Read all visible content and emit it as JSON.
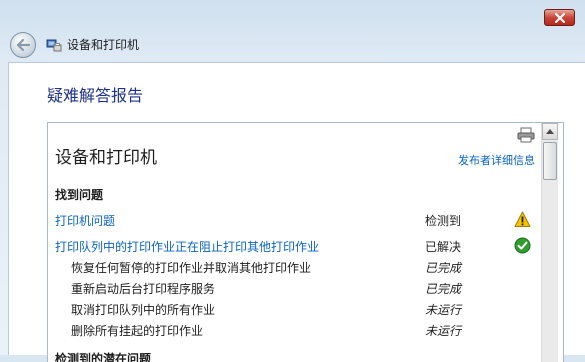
{
  "window": {
    "address_title": "设备和打印机"
  },
  "page": {
    "title": "疑难解答报告"
  },
  "report": {
    "title": "设备和打印机",
    "publisher_link": "发布者详细信息",
    "section_heading": "找到问题",
    "problems": [
      {
        "label": "打印机问题",
        "status": "检测到",
        "status_icon": "warning-icon"
      },
      {
        "label": "打印队列中的打印作业正在阻止打印其他打印作业",
        "status": "已解决",
        "status_icon": "check-icon"
      }
    ],
    "actions": [
      {
        "label": "恢复任何暂停的打印作业并取消其他打印作业",
        "status": "已完成"
      },
      {
        "label": "重新启动后台打印程序服务",
        "status": "已完成"
      },
      {
        "label": "取消打印队列中的所有作业",
        "status": "未运行"
      },
      {
        "label": "删除所有挂起的打印作业",
        "status": "未运行"
      }
    ],
    "next_heading_partial": "检测到的潜在问题"
  },
  "colors": {
    "link": "#0b64c0",
    "title_blue": "#1e3287",
    "warning": "#f5c400",
    "success": "#2f9e2f"
  }
}
